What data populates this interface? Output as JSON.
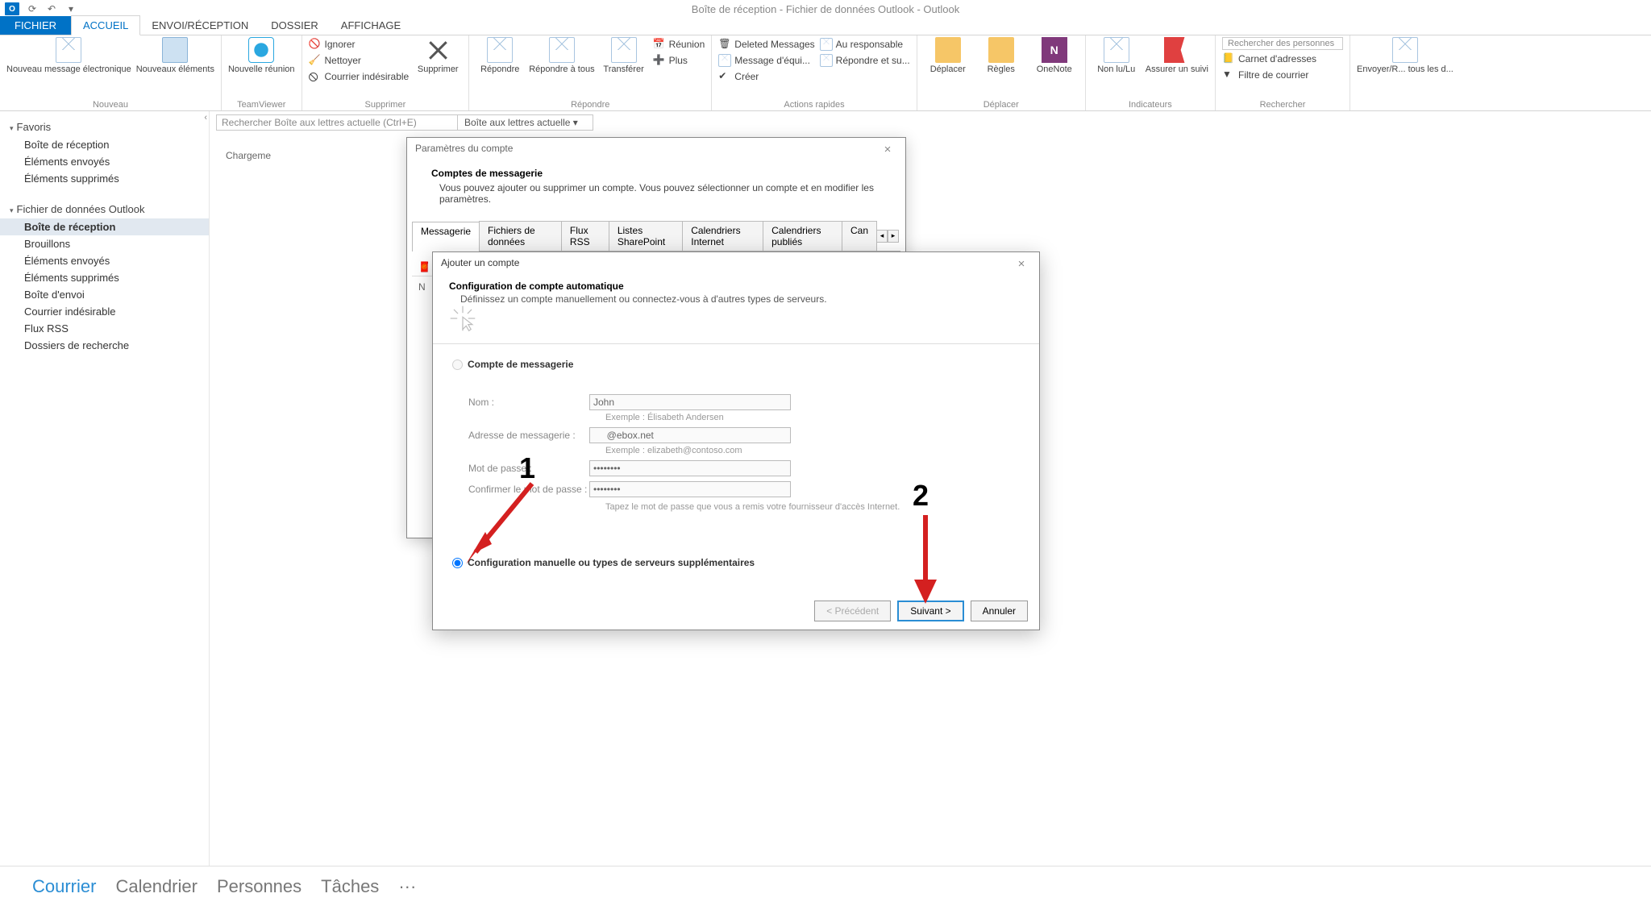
{
  "window": {
    "title": "Boîte de réception - Fichier de données Outlook - Outlook",
    "app_glyph": "O"
  },
  "tabs": {
    "file": "FICHIER",
    "home": "ACCUEIL",
    "sendrecv": "ENVOI/RÉCEPTION",
    "folder": "DOSSIER",
    "view": "AFFICHAGE"
  },
  "ribbon": {
    "new_message": "Nouveau message électronique",
    "new_items": "Nouveaux éléments",
    "new_teamviewer": "Nouvelle réunion",
    "ignore": "Ignorer",
    "clean": "Nettoyer",
    "junk": "Courrier indésirable",
    "delete": "Supprimer",
    "reply": "Répondre",
    "reply_all": "Répondre à tous",
    "forward": "Transférer",
    "meeting": "Réunion",
    "more": "Plus",
    "qs_deleted": "Deleted Messages",
    "qs_to_mgr": "Au responsable",
    "qs_team": "Message d'équi...",
    "qs_reply_del": "Répondre et su...",
    "qs_create": "Créer",
    "move": "Déplacer",
    "rules": "Règles",
    "onenote": "OneNote",
    "unread": "Non lu/Lu",
    "followup": "Assurer un suivi",
    "search_people": "Rechercher des personnes",
    "address_book": "Carnet d'adresses",
    "filter": "Filtre de courrier",
    "send_receive": "Envoyer/R... tous les d...",
    "grp_new": "Nouveau",
    "grp_tv": "TeamViewer",
    "grp_delete": "Supprimer",
    "grp_respond": "Répondre",
    "grp_quick": "Actions rapides",
    "grp_move": "Déplacer",
    "grp_tags": "Indicateurs",
    "grp_find": "Rechercher"
  },
  "nav": {
    "favorites": "Favoris",
    "fav_inbox": "Boîte de réception",
    "fav_sent": "Éléments envoyés",
    "fav_deleted": "Éléments supprimés",
    "datafile": "Fichier de données Outlook",
    "inbox": "Boîte de réception",
    "drafts": "Brouillons",
    "sent": "Éléments envoyés",
    "deleted": "Éléments supprimés",
    "outbox": "Boîte d'envoi",
    "junk": "Courrier indésirable",
    "rss": "Flux RSS",
    "search_folders": "Dossiers de recherche"
  },
  "search": {
    "placeholder": "Rechercher Boîte aux lettres actuelle (Ctrl+E)",
    "scope": "Boîte aux lettres actuelle"
  },
  "loading": "Chargeme",
  "dlg1": {
    "title": "Paramètres du compte",
    "heading": "Comptes de messagerie",
    "sub": "Vous pouvez ajouter ou supprimer un compte. Vous pouvez sélectionner un compte et en modifier les paramètres.",
    "tabs": {
      "mail": "Messagerie",
      "data": "Fichiers de données",
      "rss": "Flux RSS",
      "sharepoint": "Listes SharePoint",
      "ical": "Calendriers Internet",
      "pubcal": "Calendriers publiés",
      "more": "Can"
    },
    "col_n": "N"
  },
  "dlg2": {
    "title": "Ajouter un compte",
    "heading": "Configuration de compte automatique",
    "sub": "Définissez un compte manuellement ou connectez-vous à d'autres types de serveurs.",
    "radio_email": "Compte de messagerie",
    "radio_manual": "Configuration manuelle ou types de serveurs supplémentaires",
    "name_label": "Nom :",
    "name_value": "John",
    "name_hint": "Exemple : Élisabeth Andersen",
    "email_label": "Adresse de messagerie :",
    "email_value": "     @ebox.net",
    "email_hint": "Exemple : elizabeth@contoso.com",
    "pw_label": "Mot de passe :",
    "pw_value": "••••••••",
    "pw2_label": "Confirmer le mot de passe :",
    "pw2_value": "••••••••",
    "pw_hint": "Tapez le mot de passe que vous a remis votre fournisseur d'accès Internet.",
    "btn_prev": "< Précédent",
    "btn_next": "Suivant >",
    "btn_cancel": "Annuler"
  },
  "bottom": {
    "mail": "Courrier",
    "calendar": "Calendrier",
    "people": "Personnes",
    "tasks": "Tâches",
    "more": "···"
  },
  "annotations": {
    "one": "1",
    "two": "2"
  }
}
